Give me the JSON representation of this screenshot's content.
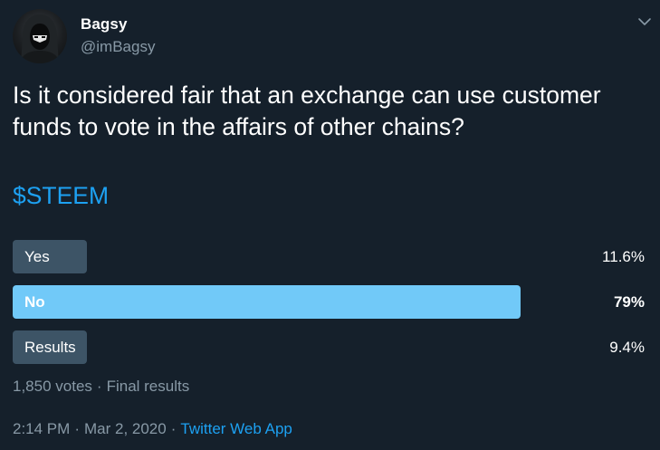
{
  "user": {
    "display_name": "Bagsy",
    "handle": "@imBagsy",
    "avatar_icon": "hooded-figure-avatar"
  },
  "menu": {
    "icon": "chevron-down-icon"
  },
  "tweet": {
    "text": "Is it considered fair that an exchange can use customer\nfunds to vote in the affairs of other chains?",
    "hashtag": "$STEEM"
  },
  "poll": {
    "options": [
      {
        "label": "Yes",
        "percent_label": "11.6%",
        "percent": 11.6,
        "winner": false
      },
      {
        "label": "No",
        "percent_label": "79%",
        "percent": 79,
        "winner": true
      },
      {
        "label": "Results",
        "percent_label": "9.4%",
        "percent": 9.4,
        "winner": false
      }
    ],
    "votes": "1,850 votes",
    "status": "Final results"
  },
  "meta": {
    "time": "2:14 PM",
    "date": "Mar 2, 2020",
    "source": "Twitter Web App"
  },
  "colors": {
    "background": "#15202b",
    "winner_bar": "#71c9f8",
    "loser_bar": "#3d5466",
    "link": "#1da1f2",
    "secondary_text": "#8899a6"
  }
}
